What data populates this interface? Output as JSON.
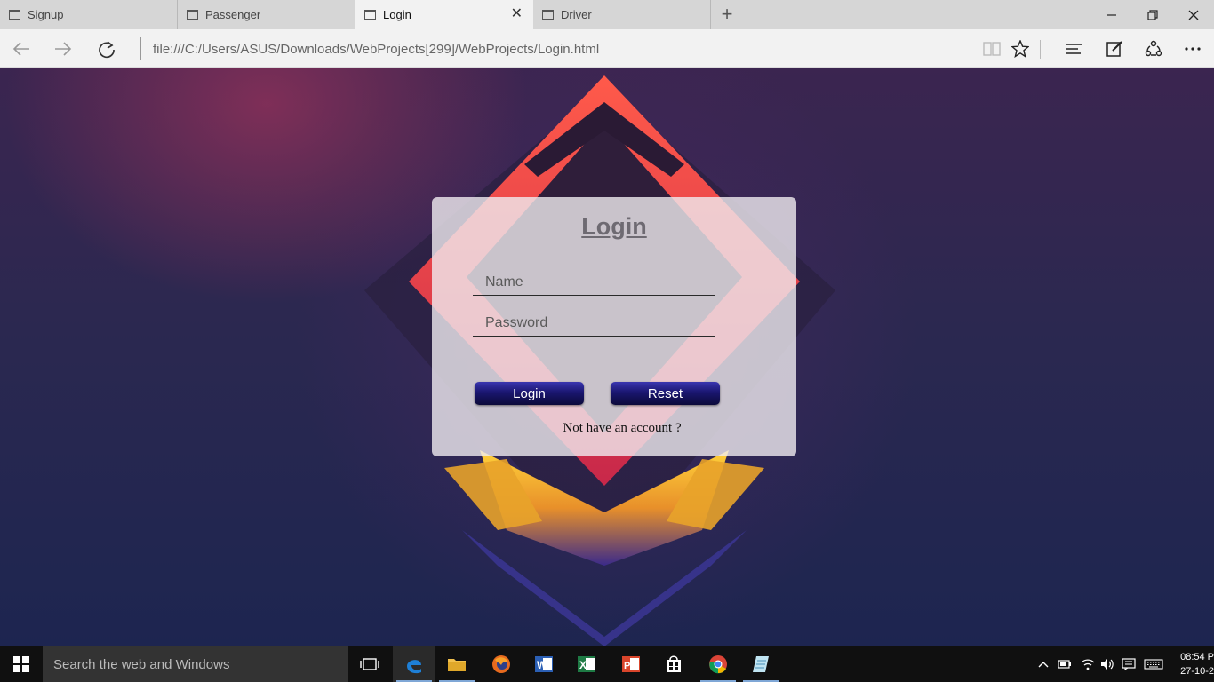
{
  "browser": {
    "tabs": [
      {
        "label": "Signup",
        "active": false
      },
      {
        "label": "Passenger",
        "active": false
      },
      {
        "label": "Login",
        "active": true
      },
      {
        "label": "Driver",
        "active": false
      }
    ],
    "url": "file:///C:/Users/ASUS/Downloads/WebProjects[299]/WebProjects/Login.html",
    "icons": {
      "back": "arrow-left-icon",
      "forward": "arrow-right-icon",
      "refresh": "refresh-icon",
      "reading_view": "book-icon",
      "favorite": "star-icon",
      "hub": "hub-icon",
      "web_note": "pen-icon",
      "share": "share-icon",
      "more": "more-icon"
    }
  },
  "login": {
    "title": "Login",
    "name_placeholder": "Name",
    "password_placeholder": "Password",
    "login_button": "Login",
    "reset_button": "Reset",
    "signup_text": "Not have an account ?"
  },
  "taskbar": {
    "search_placeholder": "Search the web and Windows",
    "clock_time": "08:54 P",
    "clock_date": "27-10-2"
  },
  "colors": {
    "button": "#1a1670",
    "card": "#f0ecf0",
    "background": "#1e2a5a"
  }
}
